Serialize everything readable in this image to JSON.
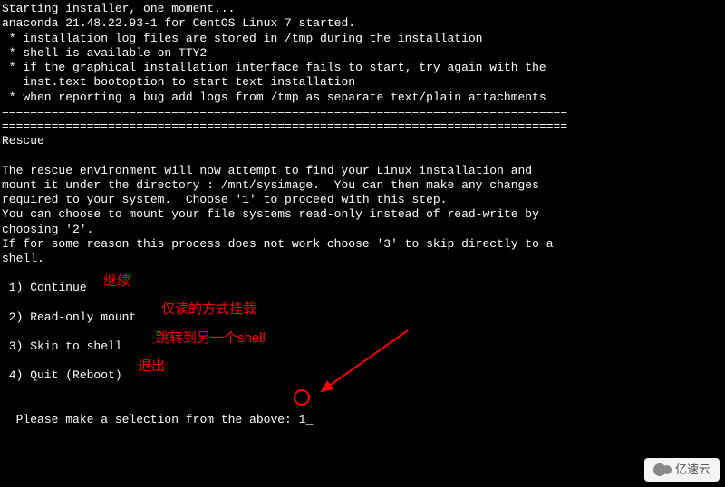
{
  "terminal": {
    "l1": "Starting installer, one moment...",
    "l2": "anaconda 21.48.22.93-1 for CentOS Linux 7 started.",
    "l3": " * installation log files are stored in /tmp during the installation",
    "l4": " * shell is available on TTY2",
    "l5": " * if the graphical installation interface fails to start, try again with the",
    "l6": "   inst.text bootoption to start text installation",
    "l7": " * when reporting a bug add logs from /tmp as separate text/plain attachments",
    "divider1": "================================================================================",
    "divider2": "================================================================================",
    "l8": "Rescue",
    "l9": "The rescue environment will now attempt to find your Linux installation and",
    "l10": "mount it under the directory : /mnt/sysimage.  You can then make any changes",
    "l11": "required to your system.  Choose '1' to proceed with this step.",
    "l12": "You can choose to mount your file systems read-only instead of read-write by",
    "l13": "choosing '2'.",
    "l14": "If for some reason this process does not work choose '3' to skip directly to a",
    "l15": "shell.",
    "options": {
      "o1": " 1) Continue",
      "o2": " 2) Read-only mount",
      "o3": " 3) Skip to shell",
      "o4": " 4) Quit (Reboot)"
    },
    "prompt": "Please make a selection from the above: ",
    "input_value": "1",
    "cursor": "_"
  },
  "annotations": {
    "a1": "继续",
    "a2": "仅读的方式挂载",
    "a3": "跳转到另一个shell",
    "a4": "退出"
  },
  "watermark": {
    "text": "亿速云"
  }
}
